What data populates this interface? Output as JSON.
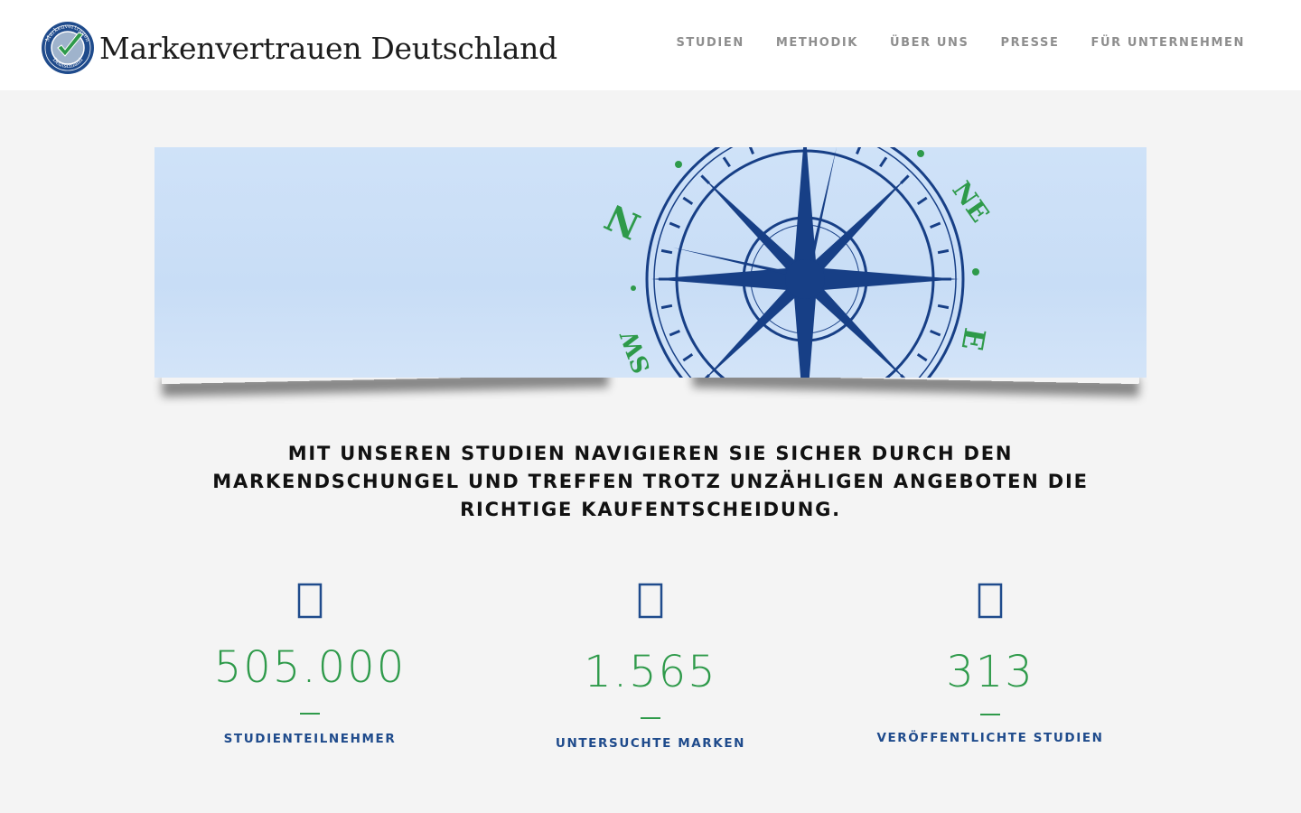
{
  "header": {
    "brand": "Markenvertrauen Deutschland",
    "logo_ring_top": "Markenvertrauen",
    "logo_ring_bottom": "Deutschland",
    "nav": [
      {
        "label": "STUDIEN"
      },
      {
        "label": "METHODIK"
      },
      {
        "label": "ÜBER UNS"
      },
      {
        "label": "PRESSE"
      },
      {
        "label": "FÜR UNTERNEHMEN"
      }
    ]
  },
  "banner": {
    "compass_labels": {
      "n": "N",
      "ne": "NE",
      "e": "E",
      "sw": "SW"
    }
  },
  "headline": "MIT UNSEREN STUDIEN NAVIGIEREN SIE SICHER DURCH DEN MARKENDSCHUNGEL UND TREFFEN TROTZ UNZÄHLIGEN ANGEBOTEN DIE RICHTIGE KAUFENTSCHEIDUNG.",
  "stats": [
    {
      "icon": "people-icon",
      "value": "505.000",
      "label": "STUDIENTEILNEHMER"
    },
    {
      "icon": "tag-icon",
      "value": "1.565",
      "label": "UNTERSUCHTE MARKEN"
    },
    {
      "icon": "document-icon",
      "value": "313",
      "label": "VERÖFFENTLICHTE STUDIEN"
    }
  ],
  "colors": {
    "accent_green": "#2e9a4a",
    "accent_blue": "#1f4b8c",
    "compass_navy": "#173f86",
    "background": "#f4f4f4"
  }
}
